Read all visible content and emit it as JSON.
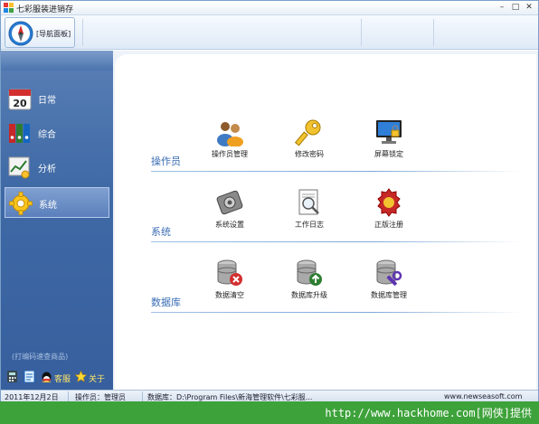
{
  "window": {
    "title": "七彩服装进销存",
    "minimize_glyph": "–",
    "maximize_glyph": "□",
    "close_glyph": "✕"
  },
  "ribbon": {
    "nav_button_label": "[导航面板]"
  },
  "sidebar": {
    "items": [
      {
        "label": "日常",
        "icon": "calendar-icon"
      },
      {
        "label": "综合",
        "icon": "binders-icon"
      },
      {
        "label": "分析",
        "icon": "chart-icon"
      },
      {
        "label": "系统",
        "icon": "gear-icon",
        "active": true
      }
    ],
    "scan_hint": "(打编码速查商品)",
    "tools": [
      {
        "label": "",
        "icon": "calculator-icon"
      },
      {
        "label": "",
        "icon": "notepad-icon"
      },
      {
        "label": "客服",
        "icon": "qq-icon"
      },
      {
        "label": "关于",
        "icon": "star-icon"
      }
    ]
  },
  "main": {
    "sections": [
      {
        "title": "操作员",
        "features": [
          {
            "label": "操作员管理",
            "icon": "users-icon"
          },
          {
            "label": "修改密码",
            "icon": "key-icon"
          },
          {
            "label": "屏幕锁定",
            "icon": "monitor-lock-icon"
          }
        ]
      },
      {
        "title": "系统",
        "features": [
          {
            "label": "系统设置",
            "icon": "settings-icon"
          },
          {
            "label": "工作日志",
            "icon": "log-icon"
          },
          {
            "label": "正版注册",
            "icon": "seal-icon"
          }
        ]
      },
      {
        "title": "数据库",
        "features": [
          {
            "label": "数据清空",
            "icon": "db-clear-icon"
          },
          {
            "label": "数据库升级",
            "icon": "db-upgrade-icon"
          },
          {
            "label": "数据库管理",
            "icon": "db-manage-icon"
          }
        ]
      }
    ]
  },
  "statusbar": {
    "date": "2011年12月2日",
    "operator": "操作员：管理员",
    "database": "数据库：D:\\Program Files\\新海管理软件\\七彩服...",
    "website": "www.newseasoft.com"
  },
  "footer": {
    "watermark": "http://www.hackhome.com[网侠]提供"
  },
  "colors": {
    "sidebar_blue": "#3f6aa6",
    "section_title": "#3a6db4",
    "footer_green": "#3da23a",
    "tool_label": "#ffe66a"
  }
}
